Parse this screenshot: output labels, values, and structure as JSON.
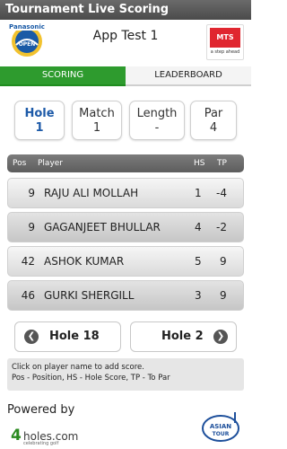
{
  "app": {
    "title": "Tournament Live Scoring"
  },
  "header": {
    "title": "App Test 1",
    "left_logo": {
      "name": "panasonic-open-logo",
      "text": "Panasonic OPEN"
    },
    "right_logo": {
      "name": "mts-logo",
      "text": "MTS",
      "tagline": "a step ahead"
    }
  },
  "tabs": [
    {
      "label": "SCORING",
      "active": true
    },
    {
      "label": "LEADERBOARD",
      "active": false
    }
  ],
  "stats": [
    {
      "label": "Hole",
      "value": "1"
    },
    {
      "label": "Match",
      "value": "1"
    },
    {
      "label": "Length",
      "value": "-"
    },
    {
      "label": "Par",
      "value": "4"
    }
  ],
  "leaderboard": {
    "columns": {
      "pos": "Pos",
      "player": "Player",
      "hs": "HS",
      "tp": "TP"
    },
    "rows": [
      {
        "pos": "9",
        "player": "RAJU ALI MOLLAH",
        "hs": "1",
        "tp": "-4"
      },
      {
        "pos": "9",
        "player": "GAGANJEET BHULLAR",
        "hs": "4",
        "tp": "-2"
      },
      {
        "pos": "42",
        "player": "ASHOK KUMAR",
        "hs": "5",
        "tp": "9"
      },
      {
        "pos": "46",
        "player": "GURKI SHERGILL",
        "hs": "3",
        "tp": "9"
      }
    ]
  },
  "nav": {
    "prev_label": "Hole 18",
    "next_label": "Hole 2",
    "prev_icon": "chevron-left-icon",
    "next_icon": "chevron-right-icon"
  },
  "help": {
    "line1": "Click on player name to add score.",
    "line2": "Pos - Position, HS - Hole Score, TP - To Par"
  },
  "footer": {
    "powered_by": "Powered by",
    "brand_num": "4",
    "brand_text": "holes.com",
    "brand_sub": "celebrating golf",
    "asian_tour": "ASIAN TOUR"
  },
  "colors": {
    "accent_green": "#2e9b2e",
    "hole_blue": "#1d5aa8",
    "mts_red": "#e0262f"
  }
}
